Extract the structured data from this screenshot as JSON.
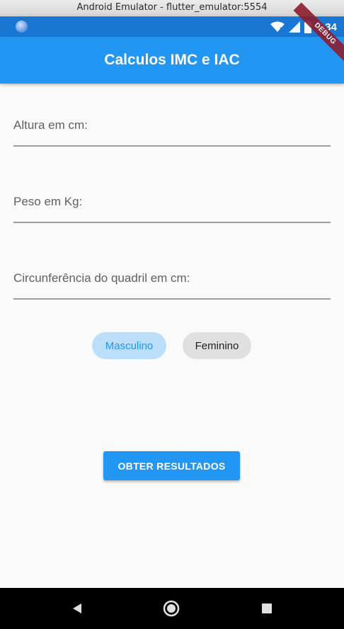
{
  "window": {
    "title": "Android Emulator - flutter_emulator:5554"
  },
  "status_bar": {
    "time": "7:34",
    "icons": [
      "wifi-icon",
      "signal-icon",
      "battery-icon"
    ],
    "debug_banner": "DEBUG",
    "color": "#1976d2"
  },
  "app_bar": {
    "title": "Calculos IMC e IAC",
    "color": "#2196f3"
  },
  "form": {
    "height_label": "Altura em cm:",
    "weight_label": "Peso em Kg:",
    "hip_label": "Circunferência do quadril em cm:"
  },
  "gender": {
    "male_label": "Masculino",
    "female_label": "Feminino",
    "selected": "Masculino"
  },
  "submit": {
    "label": "OBTER RESULTADOS"
  },
  "nav": {
    "icons": [
      "back-icon",
      "home-icon",
      "recents-icon"
    ]
  }
}
